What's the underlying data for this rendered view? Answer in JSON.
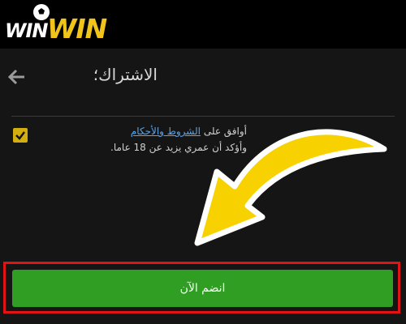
{
  "brand": {
    "logo_white": "WIN",
    "logo_gold": "WIN",
    "logo_gold_color": "#f0c419"
  },
  "header": {
    "title": "الاشتراك؛",
    "back_icon": "arrow-left-icon"
  },
  "terms": {
    "checked": true,
    "prefix": "أوافق على",
    "link_label": "الشروط والأحكام",
    "confirm_age": "وأؤكد أن عمري يزيد عن 18 عاما."
  },
  "cta": {
    "join_label": "انضم الآن",
    "button_color": "#2f9e23",
    "highlight_color": "#e01414"
  },
  "annotation": {
    "arrow_icon": "yellow-curved-arrow-icon",
    "arrow_color": "#f7d100"
  }
}
